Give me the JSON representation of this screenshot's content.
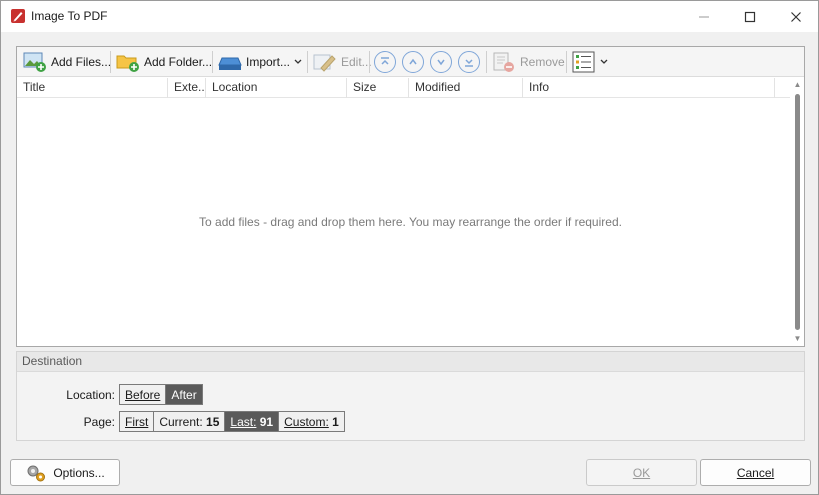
{
  "window": {
    "title": "Image To PDF"
  },
  "toolbar": {
    "add_files": "Add Files...",
    "add_folder": "Add Folder...",
    "import": "Import...",
    "edit": "Edit...",
    "remove": "Remove"
  },
  "columns": [
    "Title",
    "Exte...",
    "Location",
    "Size",
    "Modified",
    "Info"
  ],
  "list": {
    "empty_hint": "To add files - drag and drop them here. You may rearrange the order if required."
  },
  "destination": {
    "heading": "Destination",
    "location_label": "Location:",
    "location_options": [
      "Before",
      "After"
    ],
    "location_selected": "After",
    "page_label": "Page:",
    "page_first": "First",
    "page_current_label": "Current:",
    "page_current_value": "15",
    "page_last_label": "Last:",
    "page_last_value": "91",
    "page_custom_label": "Custom:",
    "page_custom_value": "1"
  },
  "buttons": {
    "options": "Options...",
    "ok": "OK",
    "cancel": "Cancel"
  },
  "colors": {
    "accent_round": "#7fa6d8",
    "segment_active": "#5a5a5a",
    "app_icon_red": "#c8312f"
  }
}
